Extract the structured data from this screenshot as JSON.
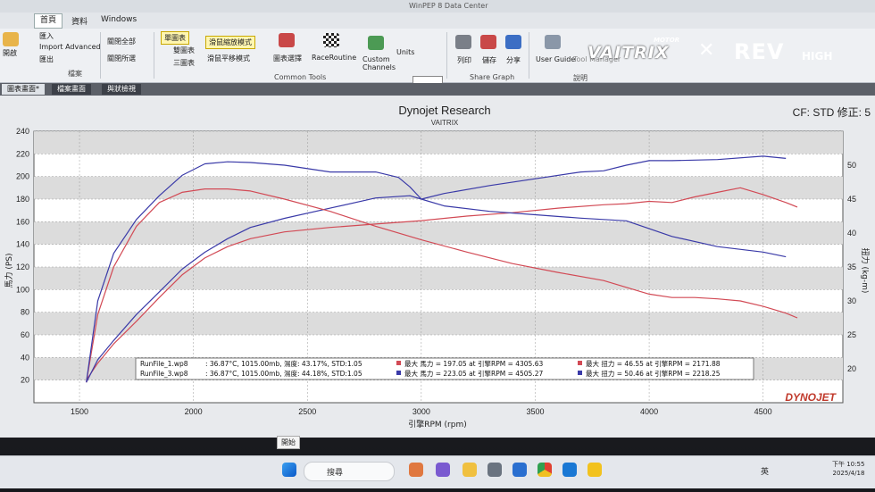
{
  "window": {
    "title": "WinPEP 8 Data Center"
  },
  "menu": {
    "tabs": [
      "首頁",
      "資料",
      "Windows"
    ],
    "active": 0
  },
  "ribbon": {
    "file_items": [
      "開啟",
      "匯入",
      "Import Advanced",
      "匯出"
    ],
    "file_group": "檔案",
    "close_all": "關閉全部",
    "close_selected": "關閉所選",
    "view_single": "單圖表",
    "view_double": "雙圖表",
    "view_triple": "三圖表",
    "mouse_zoom": "滑鼠縮放模式",
    "mouse_pan": "滑鼠平移模式",
    "chart_select": "圖表選擇",
    "race_routine": "RaceRoutine",
    "custom_channels": "Custom Channels",
    "units_label": "Units",
    "common_tools_group": "Common Tools",
    "print": "列印",
    "save": "儲存",
    "share": "分享",
    "share_group": "Share Graph",
    "user_guide": "User Guide",
    "tool_manager": "Tool Manager",
    "help_group": "說明"
  },
  "brand": {
    "vaitrix": "VAITRIX",
    "motor": "MOTOR",
    "cross": "✕",
    "rev": "REV",
    "high": "HIGH"
  },
  "doc_tabs": [
    "圖表畫面*",
    "檔案畫面",
    "與狀檢視"
  ],
  "status": {
    "start_tooltip": "開始",
    "search": "搜尋",
    "lang": "英",
    "time": "下午 10:55",
    "date": "2025/4/18"
  },
  "chart_data": {
    "type": "line",
    "title": "Dynojet Research",
    "subtitle": "VAITRIX",
    "cf_label": "CF: STD 修正: 5",
    "xlabel": "引擎RPM (rpm)",
    "ylabel_left": "馬力 (PS)",
    "ylabel_right": "扭力 (kg-m)",
    "xlim": [
      1300,
      4850
    ],
    "ylim_left": [
      0,
      240
    ],
    "ylim_right": [
      15,
      55
    ],
    "x_ticks": [
      1500,
      2000,
      2500,
      3000,
      3500,
      4000,
      4500
    ],
    "y_ticks_left": [
      20,
      40,
      60,
      80,
      100,
      120,
      140,
      160,
      180,
      200,
      220,
      240
    ],
    "y_ticks_right": [
      20,
      25,
      30,
      35,
      40,
      45,
      50
    ],
    "grid": true,
    "watermark": "DYNOJET",
    "colors": {
      "run1": "#d24a55",
      "run3": "#3a3aa8"
    },
    "series": [
      {
        "name": "RunFile_1.wp8 馬力",
        "color": "#d24a55",
        "axis": "left",
        "x": [
          1530,
          1580,
          1650,
          1750,
          1850,
          1950,
          2050,
          2150,
          2250,
          2400,
          2600,
          2800,
          3000,
          3200,
          3400,
          3600,
          3800,
          3900,
          4000,
          4100,
          4200,
          4300,
          4400,
          4500,
          4600,
          4650
        ],
        "y": [
          20,
          35,
          52,
          72,
          93,
          113,
          128,
          138,
          145,
          151,
          155,
          158,
          161,
          165,
          168,
          172,
          175,
          176,
          178,
          177,
          182,
          186,
          190,
          184,
          177,
          173
        ]
      },
      {
        "name": "RunFile_3.wp8 馬力",
        "color": "#3a3aa8",
        "axis": "left",
        "x": [
          1530,
          1580,
          1650,
          1750,
          1850,
          1950,
          2050,
          2150,
          2250,
          2400,
          2600,
          2800,
          2950,
          3000,
          3100,
          3300,
          3500,
          3700,
          3800,
          3900,
          4000,
          4100,
          4300,
          4500,
          4600
        ],
        "y": [
          18,
          38,
          55,
          78,
          98,
          118,
          133,
          145,
          155,
          163,
          172,
          181,
          183,
          180,
          185,
          192,
          198,
          204,
          205,
          210,
          214,
          214,
          215,
          218,
          216
        ]
      },
      {
        "name": "RunFile_1.wp8 扭力",
        "color": "#d24a55",
        "axis": "right",
        "x": [
          1530,
          1580,
          1650,
          1750,
          1850,
          1950,
          2050,
          2150,
          2250,
          2400,
          2600,
          2800,
          3000,
          3200,
          3400,
          3600,
          3800,
          3900,
          4000,
          4100,
          4200,
          4300,
          4400,
          4500,
          4600,
          4650
        ],
        "y": [
          18,
          28,
          35,
          41,
          44.5,
          46,
          46.5,
          46.5,
          46.2,
          45,
          43.2,
          41,
          39,
          37.2,
          35.5,
          34.2,
          33,
          32,
          31,
          30.5,
          30.5,
          30.3,
          30,
          29.2,
          28.2,
          27.5
        ]
      },
      {
        "name": "RunFile_3.wp8 扭力",
        "color": "#3a3aa8",
        "axis": "right",
        "x": [
          1530,
          1580,
          1650,
          1750,
          1850,
          1950,
          2050,
          2150,
          2250,
          2400,
          2600,
          2700,
          2800,
          2900,
          2950,
          3000,
          3100,
          3300,
          3500,
          3700,
          3900,
          4100,
          4300,
          4500,
          4600
        ],
        "y": [
          18,
          30,
          37,
          42,
          45.5,
          48.5,
          50.2,
          50.5,
          50.4,
          50,
          49,
          49,
          49,
          48.2,
          46.8,
          45,
          44,
          43.2,
          42.7,
          42.2,
          41.8,
          39.5,
          38,
          37.2,
          36.5
        ]
      }
    ],
    "legend": [
      {
        "file": "RunFile_1.wp8",
        "conditions": ": 36.87°C, 1015.00mb, 濕度: 43.17%, STD:1.05",
        "hp": "最大 馬力 = 197.05 at 引擎RPM = 4305.63",
        "tq": "最大 扭力 = 46.55 at 引擎RPM = 2171.88",
        "color": "#d24a55"
      },
      {
        "file": "RunFile_3.wp8",
        "conditions": ": 36.87°C, 1015.00mb, 濕度: 44.18%, STD:1.05",
        "hp": "最大 馬力 = 223.05 at 引擎RPM = 4505.27",
        "tq": "最大 扭力 = 50.46 at 引擎RPM = 2218.25",
        "color": "#3a3aa8"
      }
    ]
  }
}
